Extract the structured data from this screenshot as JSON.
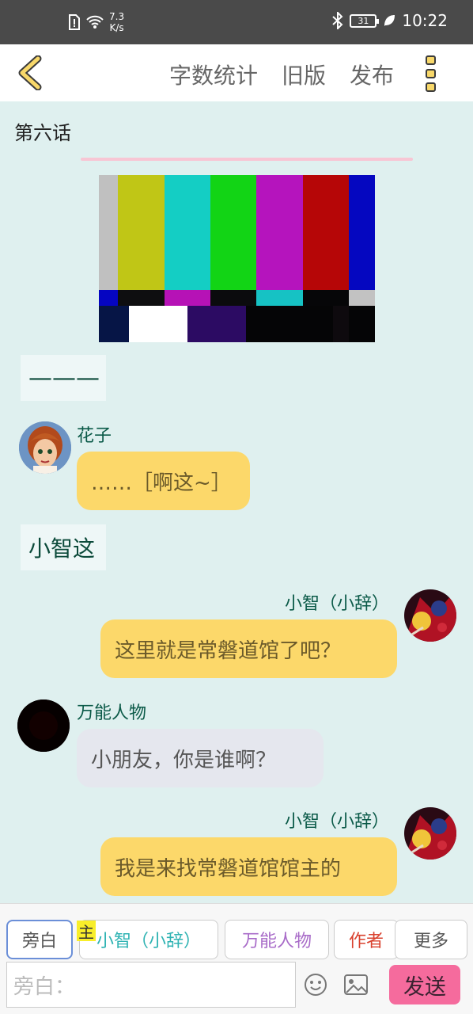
{
  "status_bar": {
    "speed_value": "7.3",
    "speed_unit": "K/s",
    "battery": "31",
    "time": "10:22"
  },
  "app_bar": {
    "actions": [
      "字数统计",
      "旧版",
      "发布"
    ]
  },
  "chapter_title": "第六话",
  "narration_1": "———",
  "messages": [
    {
      "side": "left",
      "name": "花子",
      "text": "……［啊这~］",
      "style": "yellow"
    },
    {
      "side": "right",
      "name": "小智（小辞）",
      "text": "这里就是常磐道馆了吧？",
      "style": "yellow"
    },
    {
      "side": "left",
      "name": "万能人物",
      "text": "小朋友，你是谁啊？",
      "style": "grey"
    },
    {
      "side": "right",
      "name": "小智（小辞）",
      "text": "我是来找常磐道馆馆主的",
      "style": "yellow"
    }
  ],
  "narration_2": "小智这",
  "role_chips": [
    {
      "label": "旁白",
      "color": "#555555"
    },
    {
      "label": "小智（小辞）",
      "color": "#2fb3b3",
      "badge": "主"
    },
    {
      "label": "万能人物",
      "color": "#a86bc8"
    },
    {
      "label": "作者",
      "color": "#d9412e"
    },
    {
      "label": "更多",
      "color": "#555555"
    }
  ],
  "input": {
    "placeholder": "旁白："
  },
  "send_label": "发送",
  "colors": {
    "accent_pink": "#f56b9d",
    "bubble_yellow": "#fcd86a",
    "bubble_grey": "#e5e7ee",
    "background": "#dff0ef"
  }
}
